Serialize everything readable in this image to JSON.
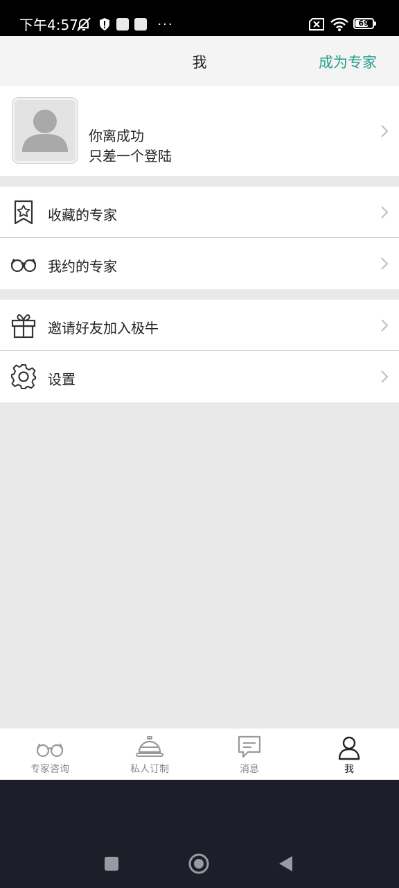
{
  "status_bar": {
    "time": "下午4:57",
    "battery": "69",
    "icons": [
      "mute-notification-icon",
      "shield-icon",
      "app-notification-icon",
      "app-notification-icon",
      "more-dots-icon",
      "no-sim-icon",
      "wifi-icon",
      "battery-icon"
    ]
  },
  "header": {
    "title": "我",
    "action": "成为专家"
  },
  "profile": {
    "line1": "你离成功",
    "line2": "只差一个登陆",
    "avatar_icon": "default-user-avatar"
  },
  "menu": {
    "items": [
      {
        "label": "收藏的专家",
        "icon": "bookmark-star-icon"
      },
      {
        "label": "我约的专家",
        "icon": "glasses-icon"
      },
      {
        "label": "邀请好友加入极牛",
        "icon": "gift-icon"
      },
      {
        "label": "设置",
        "icon": "gear-icon"
      }
    ]
  },
  "tabbar": {
    "tabs": [
      {
        "label": "专家咨询",
        "icon": "glasses-icon",
        "active": false
      },
      {
        "label": "私人订制",
        "icon": "service-bell-icon",
        "active": false
      },
      {
        "label": "消息",
        "icon": "message-icon",
        "active": false
      },
      {
        "label": "我",
        "icon": "user-icon",
        "active": true
      }
    ]
  },
  "colors": {
    "accent": "#2a9d8f",
    "background": "#e9e9e9",
    "header_bg": "#f4f4f4",
    "nav_bar": "#1e1e2b"
  }
}
